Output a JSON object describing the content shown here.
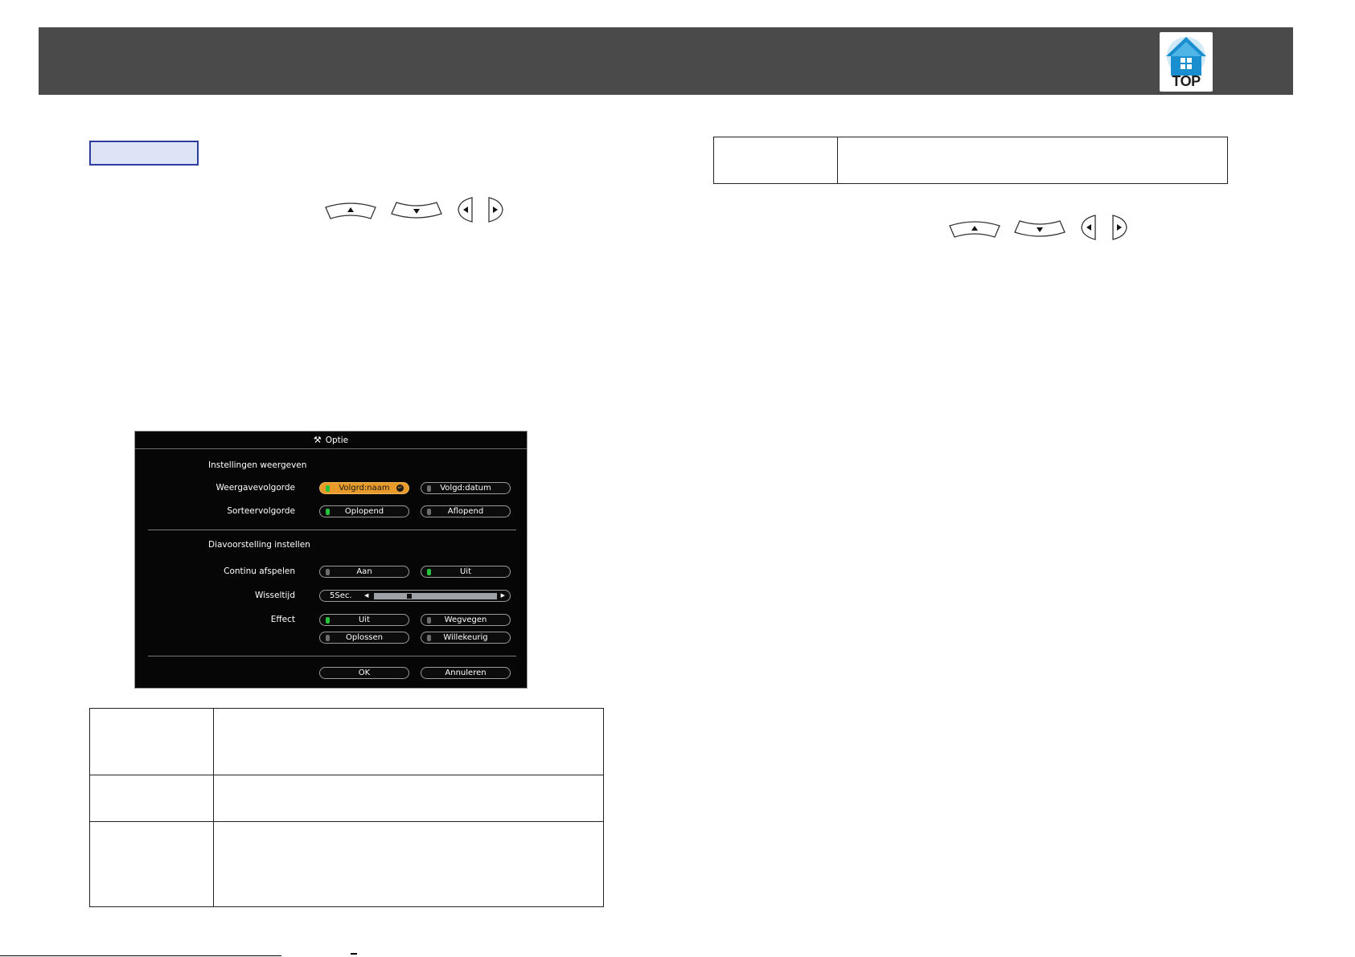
{
  "header": {
    "logo_label": "TOP",
    "logo_icon": "home-icon",
    "accent_color": "#1a8fd0"
  },
  "nav_keys": {
    "up_icon": "up-arrow-icon",
    "down_icon": "down-arrow-icon",
    "left_icon": "left-arrow-icon",
    "right_icon": "right-arrow-icon"
  },
  "dialog": {
    "title": "Optie",
    "title_icon": "wrench-icon",
    "section1_heading": "Instellingen weergeven",
    "weergavevolgorde": {
      "label": "Weergavevolgorde",
      "options": [
        "Volgrd:naam",
        "Volgd:datum"
      ],
      "selected": "Volgrd:naam"
    },
    "sorteervolgorde": {
      "label": "Sorteervolgorde",
      "options": [
        "Oplopend",
        "Aflopend"
      ],
      "selected": "Oplopend"
    },
    "section2_heading": "Diavoorstelling instellen",
    "continu": {
      "label": "Continu afspelen",
      "options": [
        "Aan",
        "Uit"
      ],
      "selected": "Uit"
    },
    "wisseltijd": {
      "label": "Wisseltijd",
      "value": "5Sec.",
      "slider_fraction": 0.28
    },
    "effect": {
      "label": "Effect",
      "options": [
        "Uit",
        "Wegvegen",
        "Oplossen",
        "Willekeurig"
      ],
      "selected": "Uit"
    },
    "ok_label": "OK",
    "cancel_label": "Annuleren",
    "selection_color": "#e89a2a",
    "active_led_color": "#27c23b"
  }
}
